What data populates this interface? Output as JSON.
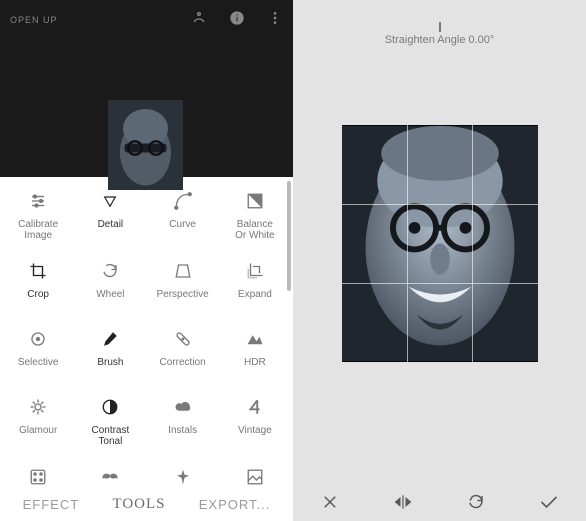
{
  "header": {
    "open_label": "OPEN UP",
    "icons": {
      "share": "share-icon",
      "info": "info-icon",
      "menu": "more-vert-icon"
    }
  },
  "tools": [
    {
      "id": "calibrate",
      "label": "Calibrate\nImage",
      "icon": "sliders-icon"
    },
    {
      "id": "detail",
      "label": "Detail",
      "icon": "triangle-down-icon",
      "dark": true
    },
    {
      "id": "curve",
      "label": "Curve",
      "icon": "curve-icon"
    },
    {
      "id": "balance",
      "label": "Balance\nOr White",
      "icon": "wb-icon"
    },
    {
      "id": "crop",
      "label": "Crop",
      "icon": "crop-icon",
      "dark": true
    },
    {
      "id": "wheel",
      "label": "Wheel",
      "icon": "rotate-icon"
    },
    {
      "id": "perspective",
      "label": "Perspective",
      "icon": "perspective-icon"
    },
    {
      "id": "expand",
      "label": "Expand",
      "icon": "expand-icon"
    },
    {
      "id": "selective",
      "label": "Selective",
      "icon": "target-icon"
    },
    {
      "id": "brush",
      "label": "Brush",
      "icon": "brush-icon",
      "dark": true
    },
    {
      "id": "correction",
      "label": "Correction",
      "icon": "bandage-icon"
    },
    {
      "id": "hdr",
      "label": "HDR",
      "icon": "mountain-icon"
    },
    {
      "id": "glamour",
      "label": "Glamour",
      "icon": "sparkle-icon"
    },
    {
      "id": "contrast",
      "label": "Contrast\nTonal",
      "icon": "half-circle-icon",
      "dark": true
    },
    {
      "id": "instals",
      "label": "Instals",
      "icon": "cloud-icon"
    },
    {
      "id": "vintage",
      "label": "Vintage",
      "icon": "four-icon"
    },
    {
      "id": "row5a",
      "label": "",
      "icon": "dice-icon"
    },
    {
      "id": "row5b",
      "label": "",
      "icon": "mustache-icon"
    },
    {
      "id": "row5c",
      "label": "",
      "icon": "spark-icon"
    },
    {
      "id": "row5d",
      "label": "",
      "icon": "image-icon"
    }
  ],
  "tabs": {
    "effect": "EFFECT",
    "tools": "TOOLS",
    "export": "EXPORT..."
  },
  "right": {
    "angle_label": "Straighten Angle 0.00°",
    "actions": {
      "cancel": "cancel-icon",
      "flip": "flip-icon",
      "rotate": "rotate-cw-icon",
      "confirm": "check-icon"
    }
  },
  "colors": {
    "grid_line": "rgba(255,255,255,0.6)",
    "panel_bg": "#e3e3e3"
  }
}
